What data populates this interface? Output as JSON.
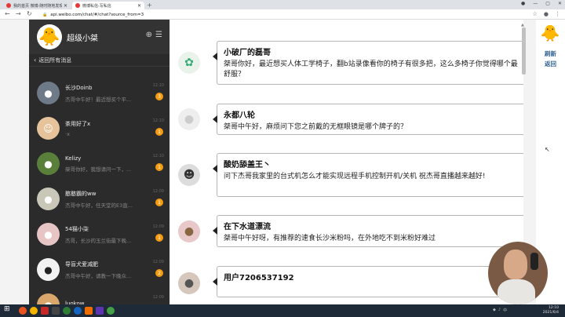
{
  "browser": {
    "tabs": [
      {
        "label": "我的首页 微博-随时随地发现新鲜事",
        "active": false
      },
      {
        "label": "微博私信-写私信",
        "active": true
      }
    ],
    "url": "api.weibo.com/chat/#/chat?source_from=3"
  },
  "chat_panel": {
    "title": "超级小桀",
    "back_label": "返回所有消息",
    "items": [
      {
        "name": "长沙Doinb",
        "preview": "杰哥中午好！最近想买个平...",
        "time": "12:10",
        "badge": "3"
      },
      {
        "name": "茶用好了x",
        "preview": "·x",
        "time": "12:10",
        "badge": "1"
      },
      {
        "name": "Kelizy",
        "preview": "桀哥你好，我想请问一下，...",
        "time": "12:10",
        "badge": "1"
      },
      {
        "name": "憨憨霸的ww",
        "preview": "杰哥中午好，任天堂的E3直...",
        "time": "12:09",
        "badge": "1"
      },
      {
        "name": "54猫小柒",
        "preview": "杰哥，长沙的玉兰街最下晚...",
        "time": "12:09",
        "badge": "1"
      },
      {
        "name": "导盲犬爱减肥",
        "preview": "杰哥中午好，请教一下晚众...",
        "time": "12:09",
        "badge": "2"
      },
      {
        "name": "luokow",
        "preview": "",
        "time": "12:09",
        "badge": ""
      }
    ]
  },
  "messages": [
    {
      "username": "小破厂的磊哥",
      "text": "桀哥你好，最近想买人体工学椅子，翻b站录像看你的椅子有很多把，这么多椅子你觉得哪个最舒服？"
    },
    {
      "username": "永都八轮",
      "text": "桀哥中午好，麻烦问下您之前戴的无框眼镜是哪个牌子的？"
    },
    {
      "username": "酸奶舔盖王丶",
      "text": "问下杰哥我家里的台式机怎么才能实现远程手机控制开机/关机  祝杰哥直播越来越好!"
    },
    {
      "username": "在下水道漂流",
      "text": "桀哥中午好呀，有推荐的速食长沙米粉吗，在外地吃不到米粉好难过"
    },
    {
      "username": "用户7206537192",
      "text": ""
    }
  ],
  "right_widget": {
    "refresh_label": "刷新",
    "return_label": "返回"
  },
  "taskbar": {
    "time": "12:10",
    "date": "2021/6/4"
  },
  "icons": {
    "chat_avatar": "duck-icon",
    "add": "plus-circle-icon",
    "menu": "list-icon"
  }
}
